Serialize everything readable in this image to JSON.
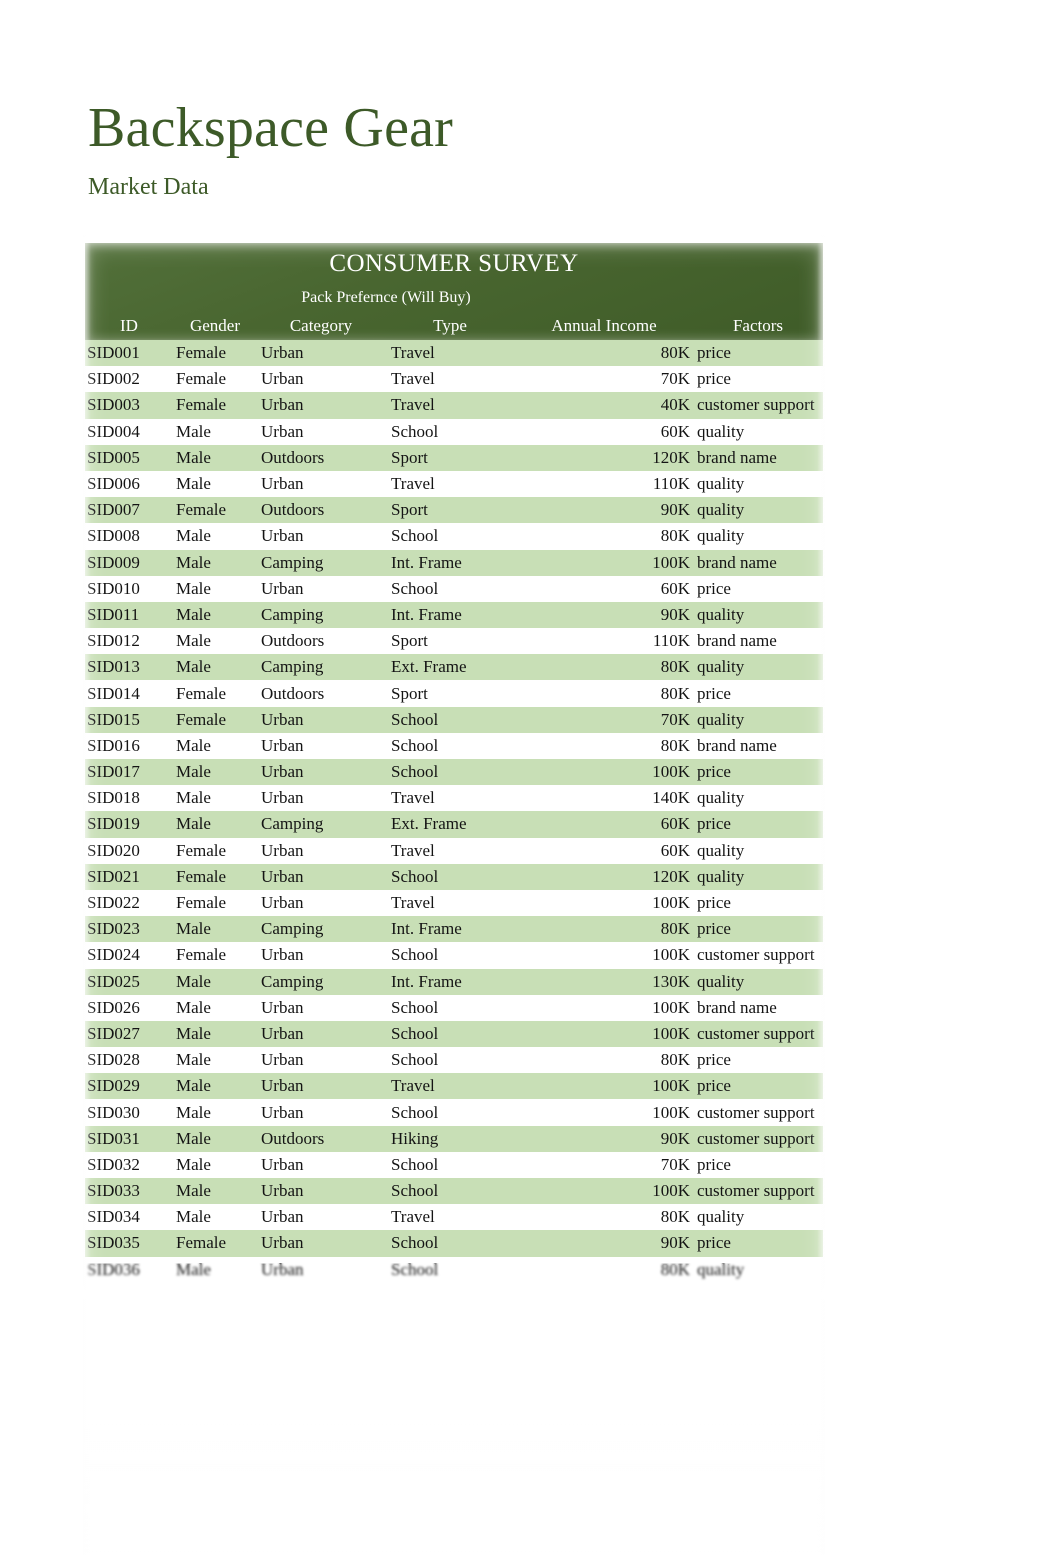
{
  "document": {
    "title": "Backspace Gear",
    "subtitle": "Market Data"
  },
  "colors": {
    "brand_green": "#3d5a28",
    "header_band": "#4a6b33",
    "stripe_green": "#c8dfb6",
    "row_plain": "#ffffff",
    "text": "#141414"
  },
  "table": {
    "title": "CONSUMER SURVEY",
    "group_header": "Pack Prefernce (Will Buy)",
    "columns": [
      {
        "key": "id",
        "label": "ID",
        "align": "left"
      },
      {
        "key": "gender",
        "label": "Gender",
        "align": "left"
      },
      {
        "key": "category",
        "label": "Category",
        "align": "left"
      },
      {
        "key": "type",
        "label": "Type",
        "align": "left"
      },
      {
        "key": "income",
        "label": "Annual Income",
        "align": "right"
      },
      {
        "key": "factors",
        "label": "Factors",
        "align": "left"
      }
    ],
    "rows": [
      {
        "id": "SID001",
        "gender": "Female",
        "category": "Urban",
        "type": "Travel",
        "income": "80K",
        "factors": "price"
      },
      {
        "id": "SID002",
        "gender": "Female",
        "category": "Urban",
        "type": "Travel",
        "income": "70K",
        "factors": "price"
      },
      {
        "id": "SID003",
        "gender": "Female",
        "category": "Urban",
        "type": "Travel",
        "income": "40K",
        "factors": "customer support"
      },
      {
        "id": "SID004",
        "gender": "Male",
        "category": "Urban",
        "type": "School",
        "income": "60K",
        "factors": "quality"
      },
      {
        "id": "SID005",
        "gender": "Male",
        "category": "Outdoors",
        "type": "Sport",
        "income": "120K",
        "factors": "brand name"
      },
      {
        "id": "SID006",
        "gender": "Male",
        "category": "Urban",
        "type": "Travel",
        "income": "110K",
        "factors": "quality"
      },
      {
        "id": "SID007",
        "gender": "Female",
        "category": "Outdoors",
        "type": "Sport",
        "income": "90K",
        "factors": "quality"
      },
      {
        "id": "SID008",
        "gender": "Male",
        "category": "Urban",
        "type": "School",
        "income": "80K",
        "factors": "quality"
      },
      {
        "id": "SID009",
        "gender": "Male",
        "category": "Camping",
        "type": "Int. Frame",
        "income": "100K",
        "factors": "brand name"
      },
      {
        "id": "SID010",
        "gender": "Male",
        "category": "Urban",
        "type": "School",
        "income": "60K",
        "factors": "price"
      },
      {
        "id": "SID011",
        "gender": "Male",
        "category": "Camping",
        "type": "Int. Frame",
        "income": "90K",
        "factors": "quality"
      },
      {
        "id": "SID012",
        "gender": "Male",
        "category": "Outdoors",
        "type": "Sport",
        "income": "110K",
        "factors": "brand name"
      },
      {
        "id": "SID013",
        "gender": "Male",
        "category": "Camping",
        "type": "Ext. Frame",
        "income": "80K",
        "factors": "quality"
      },
      {
        "id": "SID014",
        "gender": "Female",
        "category": "Outdoors",
        "type": "Sport",
        "income": "80K",
        "factors": "price"
      },
      {
        "id": "SID015",
        "gender": "Female",
        "category": "Urban",
        "type": "School",
        "income": "70K",
        "factors": "quality"
      },
      {
        "id": "SID016",
        "gender": "Male",
        "category": "Urban",
        "type": "School",
        "income": "80K",
        "factors": "brand name"
      },
      {
        "id": "SID017",
        "gender": "Male",
        "category": "Urban",
        "type": "School",
        "income": "100K",
        "factors": "price"
      },
      {
        "id": "SID018",
        "gender": "Male",
        "category": "Urban",
        "type": "Travel",
        "income": "140K",
        "factors": "quality"
      },
      {
        "id": "SID019",
        "gender": "Male",
        "category": "Camping",
        "type": "Ext. Frame",
        "income": "60K",
        "factors": "price"
      },
      {
        "id": "SID020",
        "gender": "Female",
        "category": "Urban",
        "type": "Travel",
        "income": "60K",
        "factors": "quality"
      },
      {
        "id": "SID021",
        "gender": "Female",
        "category": "Urban",
        "type": "School",
        "income": "120K",
        "factors": "quality"
      },
      {
        "id": "SID022",
        "gender": "Female",
        "category": "Urban",
        "type": "Travel",
        "income": "100K",
        "factors": "price"
      },
      {
        "id": "SID023",
        "gender": "Male",
        "category": "Camping",
        "type": "Int. Frame",
        "income": "80K",
        "factors": "price"
      },
      {
        "id": "SID024",
        "gender": "Female",
        "category": "Urban",
        "type": "School",
        "income": "100K",
        "factors": "customer support"
      },
      {
        "id": "SID025",
        "gender": "Male",
        "category": "Camping",
        "type": "Int. Frame",
        "income": "130K",
        "factors": "quality"
      },
      {
        "id": "SID026",
        "gender": "Male",
        "category": "Urban",
        "type": "School",
        "income": "100K",
        "factors": "brand name"
      },
      {
        "id": "SID027",
        "gender": "Male",
        "category": "Urban",
        "type": "School",
        "income": "100K",
        "factors": "customer support"
      },
      {
        "id": "SID028",
        "gender": "Male",
        "category": "Urban",
        "type": "School",
        "income": "80K",
        "factors": "price"
      },
      {
        "id": "SID029",
        "gender": "Male",
        "category": "Urban",
        "type": "Travel",
        "income": "100K",
        "factors": "price"
      },
      {
        "id": "SID030",
        "gender": "Male",
        "category": "Urban",
        "type": "School",
        "income": "100K",
        "factors": "customer support"
      },
      {
        "id": "SID031",
        "gender": "Male",
        "category": "Outdoors",
        "type": "Hiking",
        "income": "90K",
        "factors": "customer support"
      },
      {
        "id": "SID032",
        "gender": "Male",
        "category": "Urban",
        "type": "School",
        "income": "70K",
        "factors": "price"
      },
      {
        "id": "SID033",
        "gender": "Male",
        "category": "Urban",
        "type": "School",
        "income": "100K",
        "factors": "customer support"
      },
      {
        "id": "SID034",
        "gender": "Male",
        "category": "Urban",
        "type": "Travel",
        "income": "80K",
        "factors": "quality"
      },
      {
        "id": "SID035",
        "gender": "Female",
        "category": "Urban",
        "type": "School",
        "income": "90K",
        "factors": "price"
      },
      {
        "id": "SID036",
        "gender": "Male",
        "category": "Urban",
        "type": "School",
        "income": "80K",
        "factors": "quality"
      }
    ]
  }
}
